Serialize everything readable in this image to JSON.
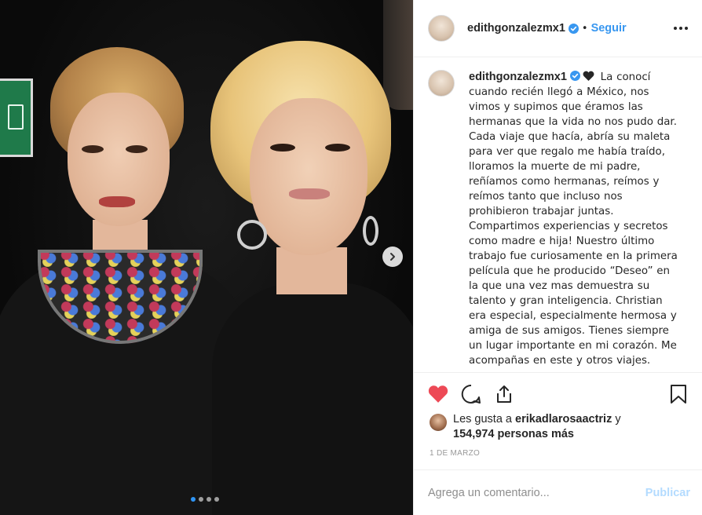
{
  "post": {
    "username": "edithgonzalezmx1",
    "separator": "•",
    "follow_label": "Seguir",
    "more_icon": "more-options-icon",
    "caption_text": "La conocí cuando recién llegó a México, nos vimos y supimos que éramos las hermanas que la vida no nos pudo dar. Cada viaje que hacía, abría su maleta para ver que regalo me había traído, lloramos la muerte de mi padre, reñíamos como hermanas, reímos y reímos tanto que incluso nos prohibieron trabajar juntas. Compartimos experiencias y secretos como madre e hija! Nuestro último trabajo fue curiosamente en la primera película que he producido “Deseo” en la que una vez mas demuestra su talento y gran inteligencia. Christian era especial, especialmente hermosa y amiga de sus amigos. Tienes siempre un lugar importante en mi corazón. Me acompañas en este y otros viajes.",
    "likes_prefix": "Les gusta a",
    "likes_user": "erikadlarosaactriz",
    "likes_joiner": "y",
    "likes_count": "154,974 personas más",
    "date": "1 DE MARZO",
    "comment_placeholder": "Agrega un comentario...",
    "publish_label": "Publicar",
    "carousel": {
      "total": 4,
      "current": 1
    },
    "colors": {
      "accent": "#3897f0",
      "like_red": "#ed4956",
      "publish_disabled": "#b3dbff"
    }
  }
}
